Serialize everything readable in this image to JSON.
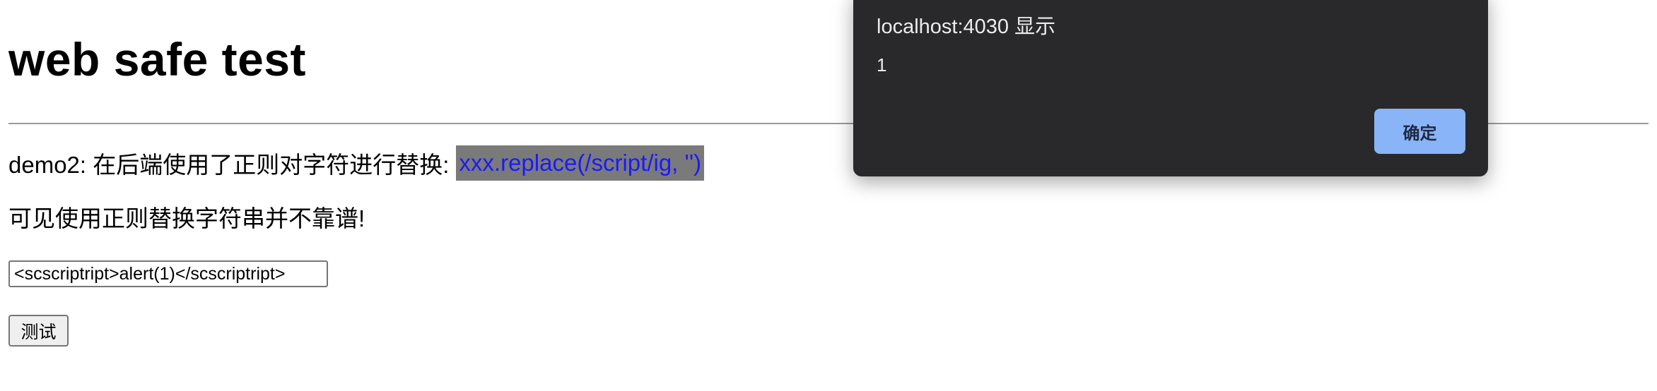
{
  "page": {
    "title": "web safe test",
    "demo_prefix": "demo2: 在后端使用了正则对字符进行替换: ",
    "demo_code": "xxx.replace(/script/ig, '')",
    "note": "可见使用正则替换字符串并不靠谱!",
    "payload_input_value": "<scscriptript>alert(1)</scscriptript>",
    "test_button_label": "测试"
  },
  "alert": {
    "title": "localhost:4030 显示",
    "message": "1",
    "ok_label": "确定"
  },
  "colors": {
    "code_text": "#1a1aff",
    "code_highlight_bg": "#7a7a7a",
    "dialog_bg": "#29292c",
    "ok_button_bg": "#8ab4f8"
  }
}
